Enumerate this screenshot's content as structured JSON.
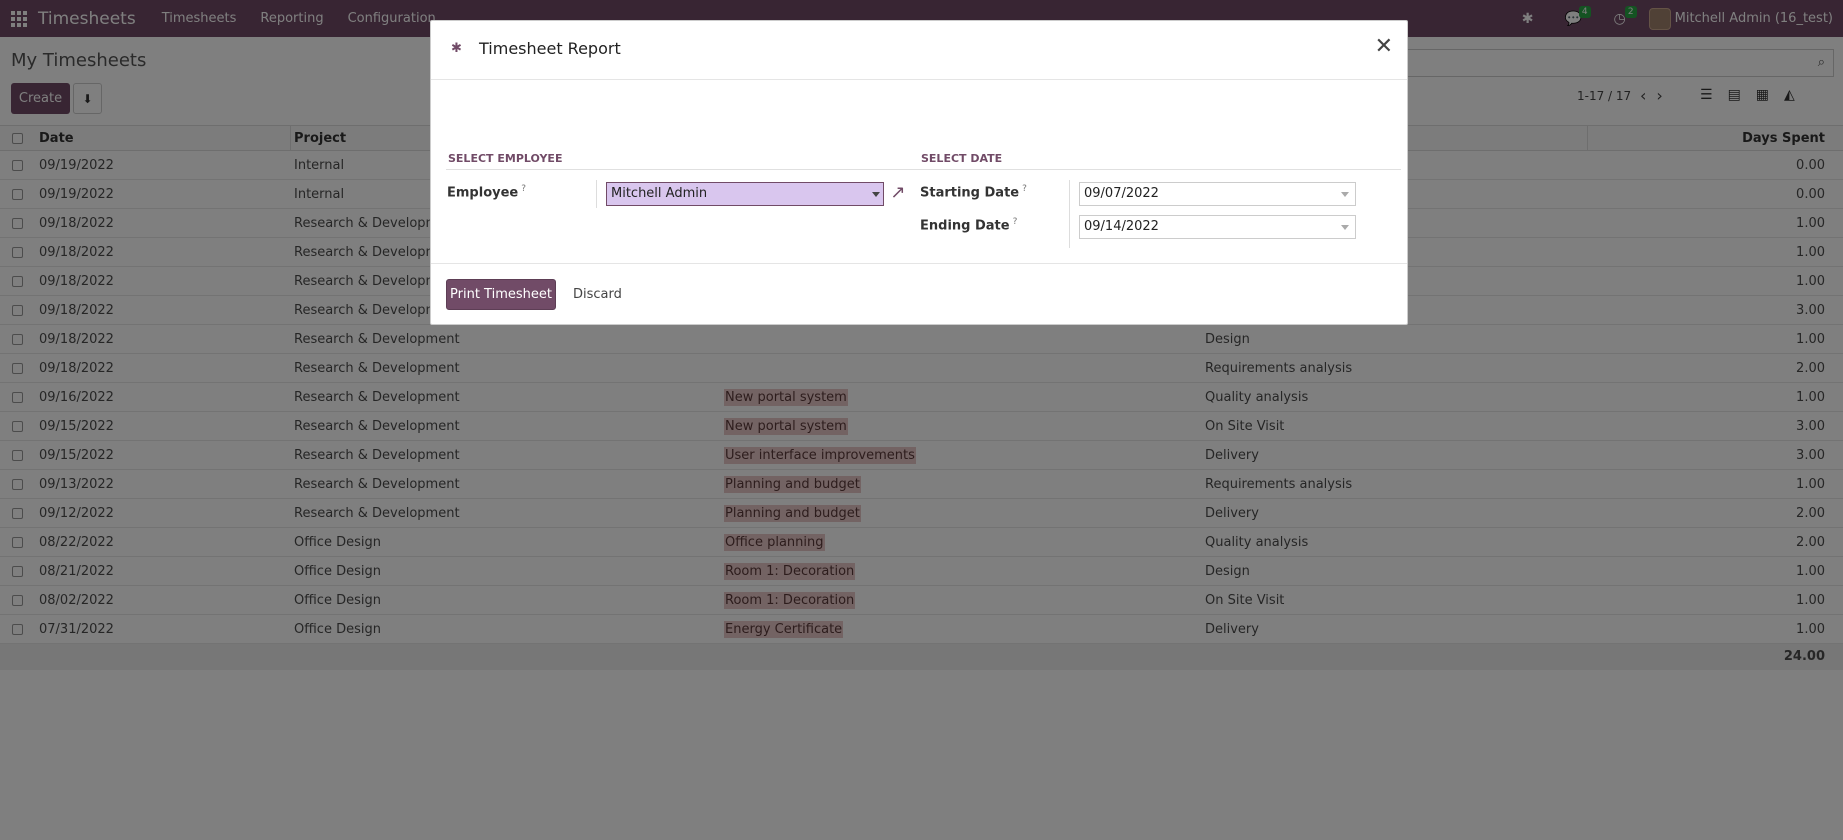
{
  "navbar": {
    "brand": "Timesheets",
    "menu": [
      "Timesheets",
      "Reporting",
      "Configuration"
    ],
    "chat_count": "4",
    "activity_count": "2",
    "user": "Mitchell Admin (16_test)"
  },
  "control_panel": {
    "title": "My Timesheets",
    "create_label": "Create",
    "pager": "1-17 / 17"
  },
  "list": {
    "headers": {
      "date": "Date",
      "project": "Project",
      "days": "Days Spent"
    },
    "rows": [
      {
        "date": "09/19/2022",
        "project": "Internal",
        "task": "",
        "desc": "",
        "days": "0.00"
      },
      {
        "date": "09/19/2022",
        "project": "Internal",
        "task": "",
        "desc": "",
        "days": "0.00"
      },
      {
        "date": "09/18/2022",
        "project": "Research & Developme",
        "task": "",
        "desc": "",
        "days": "1.00"
      },
      {
        "date": "09/18/2022",
        "project": "Research & Developme",
        "task": "",
        "desc": "",
        "days": "1.00"
      },
      {
        "date": "09/18/2022",
        "project": "Research & Developme",
        "task": "",
        "desc": "",
        "days": "1.00"
      },
      {
        "date": "09/18/2022",
        "project": "Research & Developme",
        "task": "",
        "desc": "",
        "days": "3.00"
      },
      {
        "date": "09/18/2022",
        "project": "Research & Development",
        "task": "",
        "desc": "Design",
        "days": "1.00"
      },
      {
        "date": "09/18/2022",
        "project": "Research & Development",
        "task": "",
        "desc": "Requirements analysis",
        "days": "2.00"
      },
      {
        "date": "09/16/2022",
        "project": "Research & Development",
        "task": "New portal system",
        "desc": "Quality analysis",
        "days": "1.00"
      },
      {
        "date": "09/15/2022",
        "project": "Research & Development",
        "task": "New portal system",
        "desc": "On Site Visit",
        "days": "3.00"
      },
      {
        "date": "09/15/2022",
        "project": "Research & Development",
        "task": "User interface improvements",
        "desc": "Delivery",
        "days": "3.00"
      },
      {
        "date": "09/13/2022",
        "project": "Research & Development",
        "task": "Planning and budget",
        "desc": "Requirements analysis",
        "days": "1.00"
      },
      {
        "date": "09/12/2022",
        "project": "Research & Development",
        "task": "Planning and budget",
        "desc": "Delivery",
        "days": "2.00"
      },
      {
        "date": "08/22/2022",
        "project": "Office Design",
        "task": "Office planning",
        "desc": "Quality analysis",
        "days": "2.00"
      },
      {
        "date": "08/21/2022",
        "project": "Office Design",
        "task": "Room 1: Decoration",
        "desc": "Design",
        "days": "1.00"
      },
      {
        "date": "08/02/2022",
        "project": "Office Design",
        "task": "Room 1: Decoration",
        "desc": "On Site Visit",
        "days": "1.00"
      },
      {
        "date": "07/31/2022",
        "project": "Office Design",
        "task": "Energy Certificate",
        "desc": "Delivery",
        "days": "1.00"
      }
    ],
    "total": "24.00"
  },
  "modal": {
    "title": "Timesheet Report",
    "select_employee": "Select Employee",
    "select_date": "Select Date",
    "employee_label": "Employee",
    "employee_value": "Mitchell Admin",
    "starting_date_label": "Starting Date",
    "starting_date_value": "09/07/2022",
    "ending_date_label": "Ending Date",
    "ending_date_value": "09/14/2022",
    "help_mark": "?",
    "print_label": "Print Timesheet",
    "discard_label": "Discard"
  }
}
